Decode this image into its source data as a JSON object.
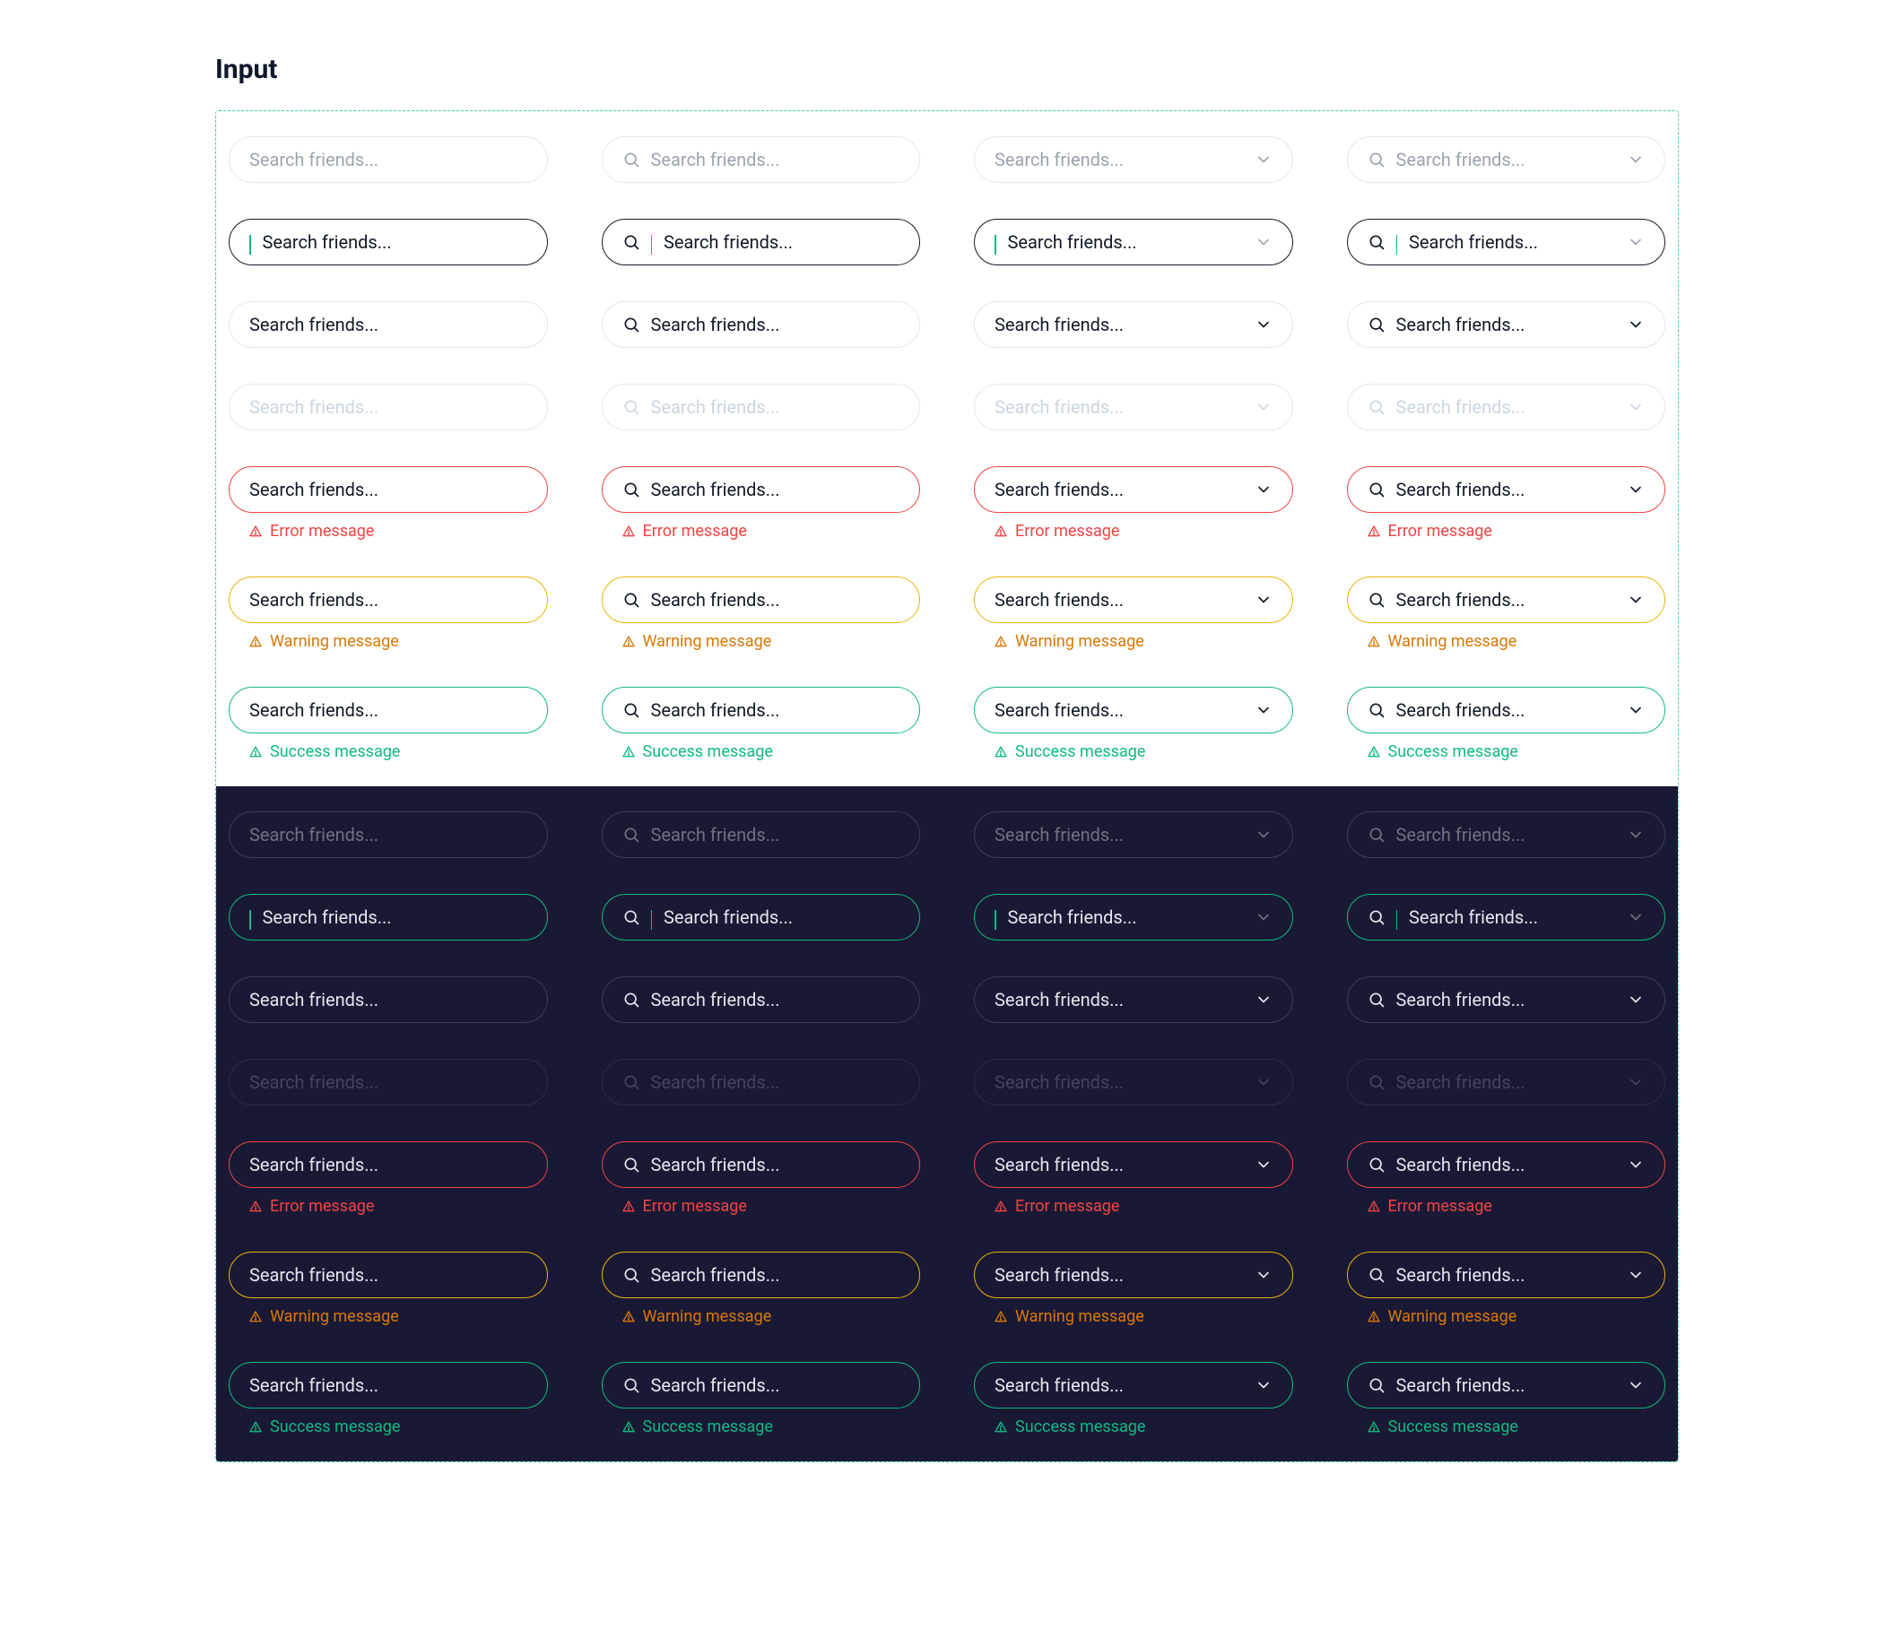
{
  "title": "Input",
  "input": {
    "placeholder": "Search friends...",
    "value": "Search friends..."
  },
  "messages": {
    "error": "Error message",
    "warning": "Warning message",
    "success": "Success message"
  },
  "states": [
    "default",
    "focus",
    "hover",
    "disabled",
    "error",
    "warning",
    "success"
  ],
  "variants": [
    {
      "id": "plain",
      "leading_icon": false,
      "trailing_chevron": false
    },
    {
      "id": "leading-search",
      "leading_icon": true,
      "trailing_chevron": false
    },
    {
      "id": "trailing-chevron",
      "leading_icon": false,
      "trailing_chevron": true
    },
    {
      "id": "search-chevron",
      "leading_icon": true,
      "trailing_chevron": true
    }
  ],
  "icons": {
    "search": "search-icon",
    "chevron_down": "chevron-down-icon",
    "alert_triangle": "alert-triangle-icon"
  },
  "colors": {
    "light_bg": "#ffffff",
    "dark_bg": "#1a1935",
    "outline_dashed": "#34d399",
    "default_border_light": "#e5e7eb",
    "default_border_dark": "#3b3a5c",
    "focus_border_light": "#111827",
    "focus_border_dark": "#10b981",
    "error": "#ef4444",
    "warning": "#eab308",
    "success": "#10b981",
    "caret": "#10b981"
  }
}
